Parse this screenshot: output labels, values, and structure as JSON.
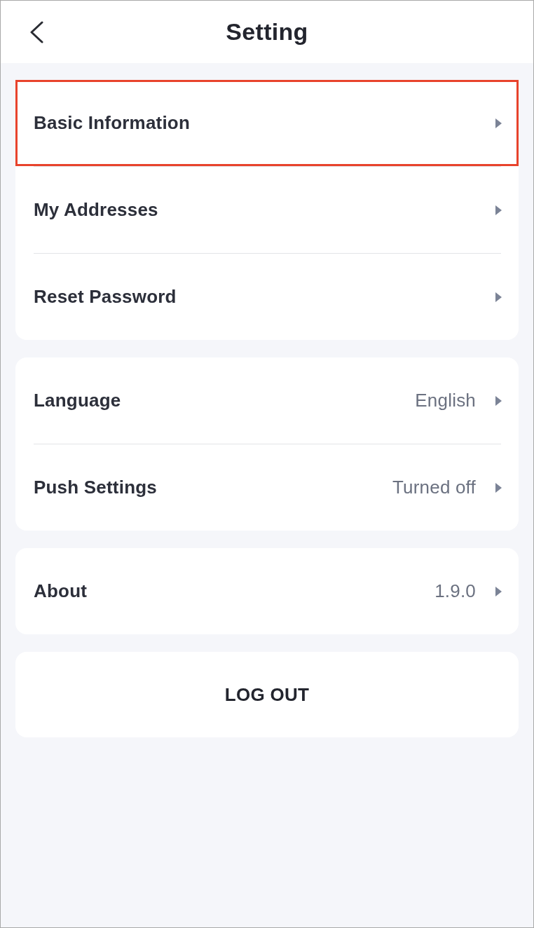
{
  "header": {
    "title": "Setting"
  },
  "groups": [
    {
      "items": [
        {
          "label": "Basic Information",
          "highlighted": true
        },
        {
          "label": "My Addresses",
          "highlighted": false
        },
        {
          "label": "Reset Password",
          "highlighted": false
        }
      ]
    },
    {
      "items": [
        {
          "label": "Language",
          "value": "English",
          "highlighted": false
        },
        {
          "label": "Push Settings",
          "value": "Turned off",
          "highlighted": false
        }
      ]
    },
    {
      "items": [
        {
          "label": "About",
          "value": "1.9.0",
          "highlighted": false
        }
      ]
    }
  ],
  "logout_button": {
    "label": "LOG OUT"
  }
}
